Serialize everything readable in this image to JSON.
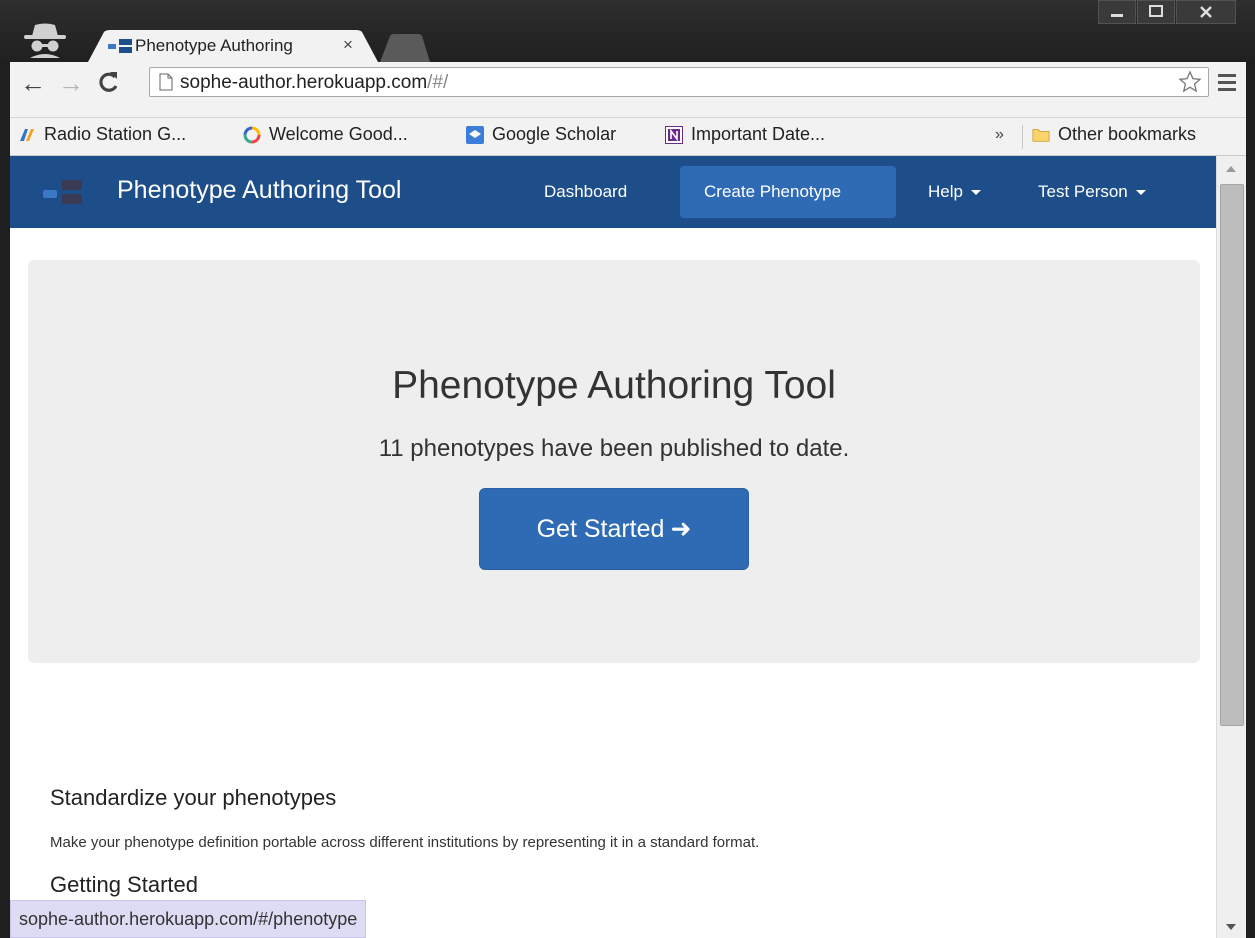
{
  "browser": {
    "tab_title": "Phenotype Authoring",
    "tab_close": "×",
    "url_host": "sophe-author.herokuapp.com",
    "url_path": "/#/",
    "bookmarks": [
      "Radio Station G...",
      "Welcome Good...",
      "Google Scholar",
      "Important Date..."
    ],
    "bookmarks_overflow": "»",
    "other_bookmarks": "Other bookmarks",
    "status_url": "sophe-author.herokuapp.com/#/phenotype"
  },
  "navbar": {
    "brand": "Phenotype Authoring Tool",
    "dashboard": "Dashboard",
    "create": "Create Phenotype",
    "help": "Help",
    "user": "Test Person"
  },
  "hero": {
    "title": "Phenotype Authoring Tool",
    "subtitle": "11 phenotypes have been published to date.",
    "button": "Get Started",
    "button_arrow": "➜"
  },
  "content": {
    "heading1": "Standardize your phenotypes",
    "para1": "Make your phenotype definition portable across different institutions by representing it in a standard format.",
    "heading2": "Getting Started"
  },
  "colors": {
    "navbar": "#1d4e89",
    "accent": "#2f6bb5",
    "hero_bg": "#eeeeee"
  }
}
